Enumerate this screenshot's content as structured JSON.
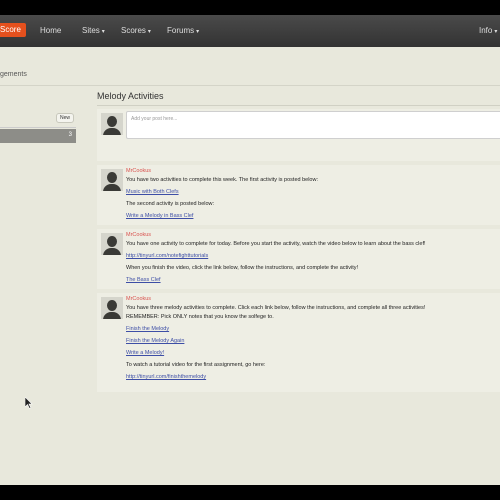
{
  "nav": {
    "brand": "Score",
    "items": [
      "Home",
      "Sites",
      "Scores",
      "Forums",
      "Info"
    ],
    "caret": "▾"
  },
  "breadcrumb": "gements",
  "sidebar": {
    "new_label": "New",
    "active_count": "3"
  },
  "main": {
    "title": "Melody Activities",
    "post_placeholder": "Add your post here..."
  },
  "posts": [
    {
      "author": "MrCookus",
      "lines": [
        "You have two activities to complete this week. The first activity is posted below:",
        "Music with Both Clefs",
        "The second activity is posted below:",
        "Write a Melody in Bass Clef"
      ]
    },
    {
      "author": "MrCookus",
      "lines": [
        "You have one activity to complete for today. Before you start the activity, watch the video below to learn about the bass clef!",
        "http://tinyurl.com/notefighttutorials",
        "When you finish the video, click the link below, follow the instructions, and complete the activity!",
        "The Bass Clef"
      ]
    },
    {
      "author": "MrCookus",
      "lines": [
        "You have three melody activities to complete. Click each link below, follow the instructions, and complete all three activities!",
        "REMEMBER: Pick ONLY notes that you know the solfege to.",
        "Finish the Melody",
        "Finish the Melody Again",
        "Write a Melody!",
        "To watch a tutorial video for the first assignment, go here:",
        "http://tinyurl.com/finishthemelody"
      ]
    }
  ]
}
